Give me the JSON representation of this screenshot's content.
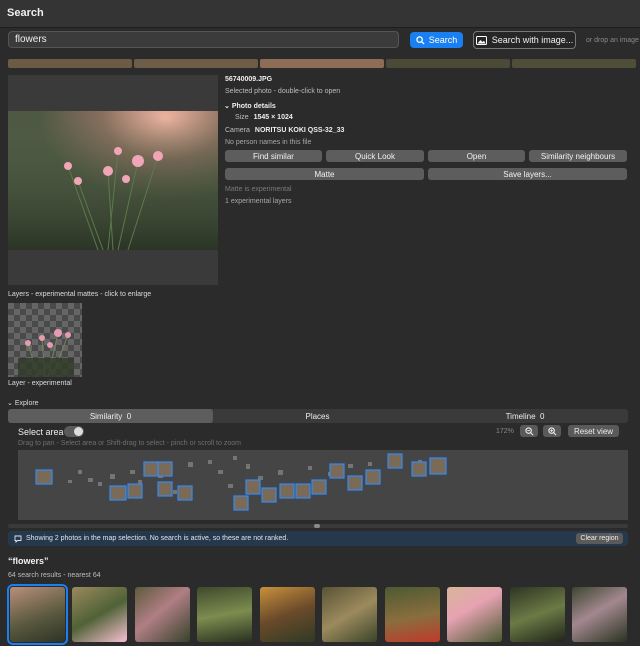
{
  "window": {
    "title": "Search"
  },
  "search": {
    "query": "flowers",
    "search_label": "Search",
    "image_search_label": "Search with image...",
    "drop_hint": "or drop an image"
  },
  "palette": [
    "#6b5b45",
    "#6d5c46",
    "#8d6d55",
    "#4a4a36",
    "#4f4e38"
  ],
  "selected": {
    "filename": "56740009.JPG",
    "hint": "Selected photo - double-click to open",
    "details_heading": "Photo details",
    "size_label": "Size",
    "size_value": "1545 × 1024",
    "camera_label": "Camera",
    "camera_value": "NORITSU KOKI QSS-32_33",
    "no_person": "No person names in this file",
    "buttons": {
      "find_similar": "Find similar",
      "quick_look": "Quick Look",
      "open": "Open",
      "similarity_neighbours": "Similarity neighbours",
      "matte": "Matte",
      "save_layers": "Save layers..."
    },
    "matte_note": "Matte is experimental",
    "layers_count": "1 experimental layers"
  },
  "layers": {
    "caption": "Layers - experimental mattes - click to enlarge",
    "layer_caption": "Layer - experimental"
  },
  "explore": {
    "heading": "Explore",
    "tabs": [
      {
        "label": "Similarity",
        "count": "0"
      },
      {
        "label": "Places",
        "count": ""
      },
      {
        "label": "Timeline",
        "count": "0"
      }
    ],
    "select_area_label": "Select area",
    "zoom": "172%",
    "reset_label": "Reset view",
    "hint": "Drag to pan - Select area or Shift-drag to select - pinch or scroll to zoom",
    "info": "Showing 2 photos in the map selection. No search is active, so these are not ranked.",
    "clear_label": "Clear region"
  },
  "results": {
    "query_title": "“flowers”",
    "count_text": "64 search results - nearest 64"
  },
  "icons": [
    "magnifier-icon",
    "photo-icon",
    "chevron-down-icon",
    "zoom-out-icon",
    "zoom-in-icon",
    "chat-bubble-icon"
  ],
  "colors": {
    "accent": "#1a7ff0",
    "background": "#2b2b2b",
    "button": "#5d5d5d"
  }
}
